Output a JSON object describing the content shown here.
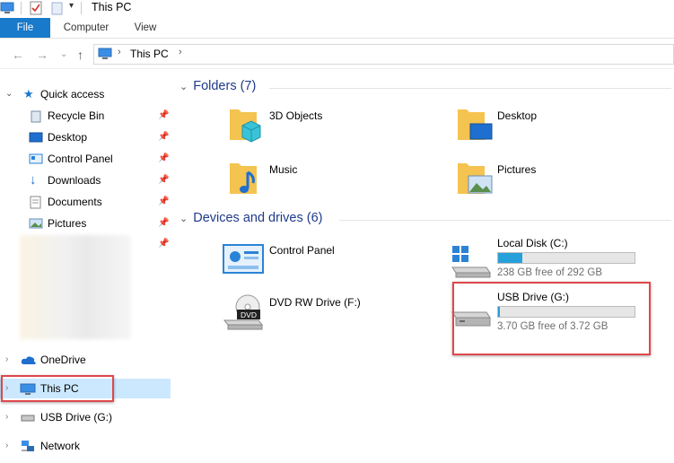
{
  "window": {
    "title": "This PC"
  },
  "ribbon": {
    "tabs": [
      "File",
      "Computer",
      "View"
    ]
  },
  "address": {
    "path_root": "This PC"
  },
  "nav": {
    "quick_access": "Quick access",
    "pinned": [
      "Recycle Bin",
      "Desktop",
      "Control Panel",
      "Downloads",
      "Documents",
      "Pictures"
    ],
    "onedrive": "OneDrive",
    "this_pc": "This PC",
    "usb": "USB Drive (G:)",
    "network": "Network"
  },
  "folders": {
    "header": "Folders (7)",
    "items": [
      "3D Objects",
      "Desktop",
      "Music",
      "Pictures"
    ]
  },
  "devices": {
    "header": "Devices and drives (6)",
    "control_panel": "Control Panel",
    "dvd": "DVD RW Drive (F:)",
    "dvd_badge": "DVD",
    "local_disk": {
      "name": "Local Disk (C:)",
      "free": "238 GB free of 292 GB",
      "used_fraction": 0.18
    },
    "usb_drive": {
      "name": "USB Drive (G:)",
      "free": "3.70 GB free of 3.72 GB",
      "used_fraction": 0.01
    }
  },
  "colors": {
    "accent": "#1979ca",
    "select": "#cce8ff",
    "highlight": "#e0474c",
    "header_blue": "#1e3a8a"
  }
}
